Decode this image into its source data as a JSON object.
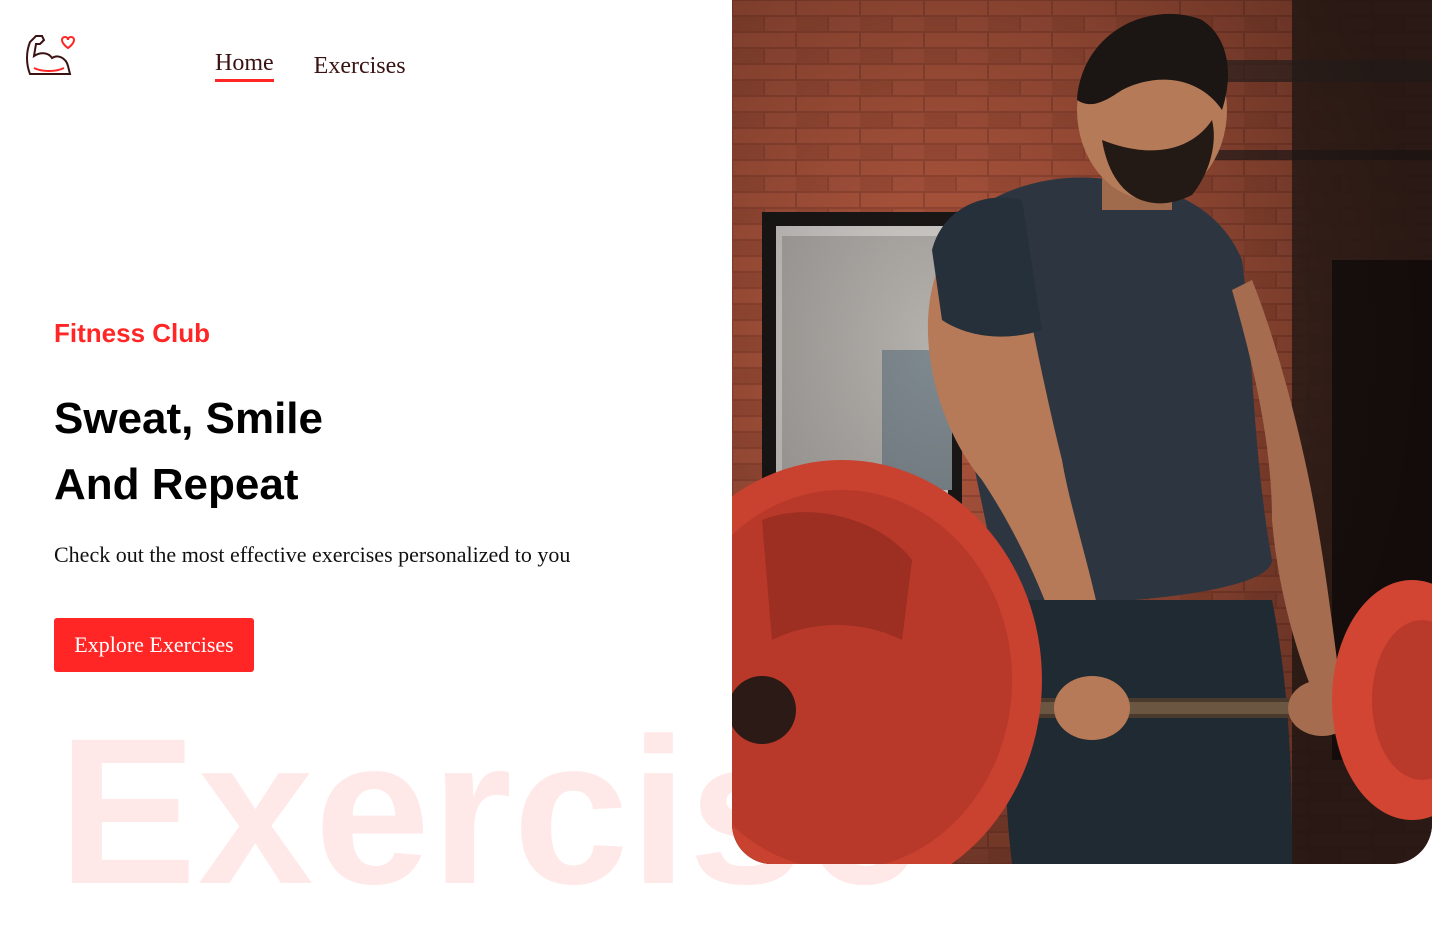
{
  "nav": {
    "logo_icon": "flexed-arm-heart-icon",
    "items": [
      {
        "label": "Home",
        "active": true
      },
      {
        "label": "Exercises",
        "active": false
      }
    ]
  },
  "hero": {
    "eyebrow": "Fitness Club",
    "headline_line1": "Sweat, Smile",
    "headline_line2": "And Repeat",
    "subtitle": "Check out the most effective exercises personalized to you",
    "cta_label": "Explore Exercises",
    "watermark": "Exercise",
    "image_alt": "man lifting barbell"
  },
  "colors": {
    "accent": "#ff2625",
    "text": "#000000",
    "nav_text": "#3a1212"
  }
}
